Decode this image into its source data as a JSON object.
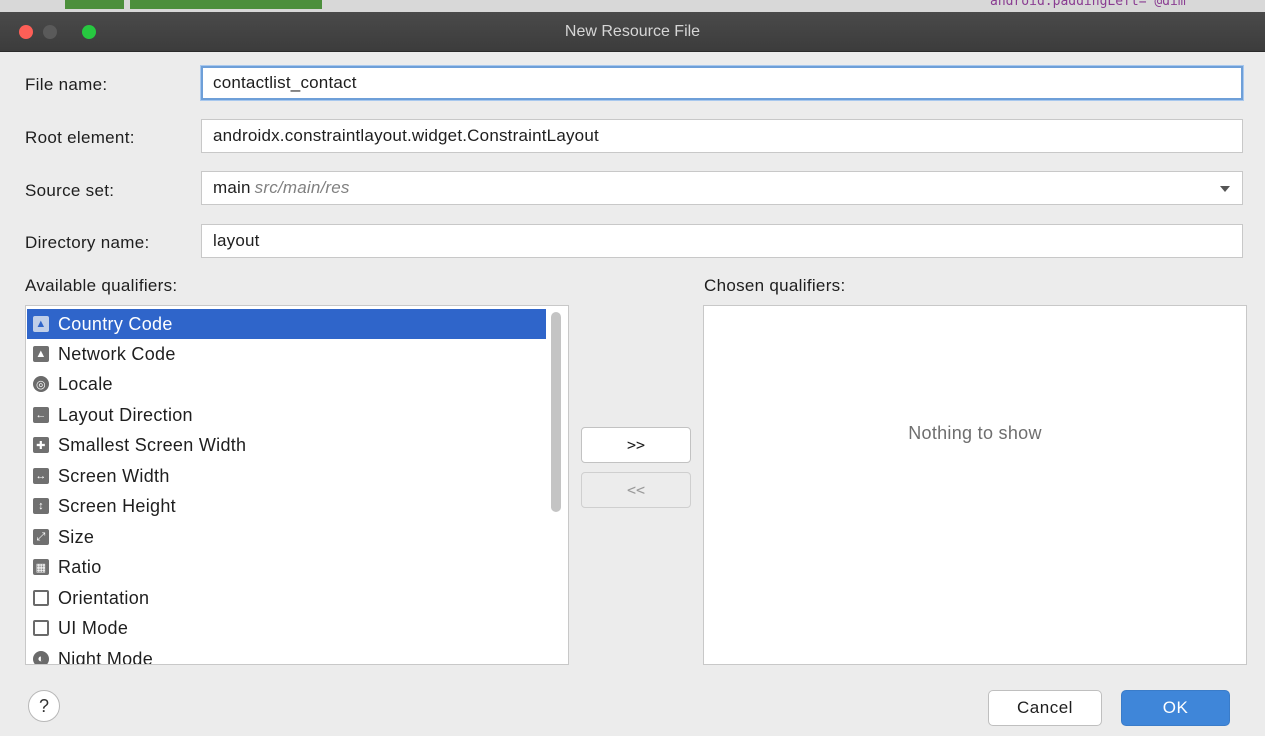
{
  "window": {
    "title": "New Resource File"
  },
  "background_code": "android:paddingLeft=\"@dim",
  "form": {
    "file_name": {
      "label": "File name:",
      "value": "contactlist_contact"
    },
    "root_element": {
      "label": "Root element:",
      "value": "androidx.constraintlayout.widget.ConstraintLayout"
    },
    "source_set": {
      "label": "Source set:",
      "value": "main",
      "hint": "src/main/res"
    },
    "directory_name": {
      "label": "Directory name:",
      "value": "layout"
    }
  },
  "available_qualifiers": {
    "label": "Available qualifiers:",
    "items": [
      {
        "label": "Country Code",
        "icon": "country-code-icon",
        "selected": true
      },
      {
        "label": "Network Code",
        "icon": "network-code-icon",
        "selected": false
      },
      {
        "label": "Locale",
        "icon": "globe-icon",
        "selected": false
      },
      {
        "label": "Layout Direction",
        "icon": "layout-direction-icon",
        "selected": false
      },
      {
        "label": "Smallest Screen Width",
        "icon": "smallest-width-icon",
        "selected": false
      },
      {
        "label": "Screen Width",
        "icon": "screen-width-icon",
        "selected": false
      },
      {
        "label": "Screen Height",
        "icon": "screen-height-icon",
        "selected": false
      },
      {
        "label": "Size",
        "icon": "size-icon",
        "selected": false
      },
      {
        "label": "Ratio",
        "icon": "ratio-icon",
        "selected": false
      },
      {
        "label": "Orientation",
        "icon": "orientation-icon",
        "selected": false
      },
      {
        "label": "UI Mode",
        "icon": "ui-mode-icon",
        "selected": false
      },
      {
        "label": "Night Mode",
        "icon": "night-mode-icon",
        "selected": false
      }
    ]
  },
  "transfer": {
    "add_label": ">>",
    "remove_label": "<<"
  },
  "chosen_qualifiers": {
    "label": "Chosen qualifiers:",
    "empty_text": "Nothing to show"
  },
  "buttons": {
    "help_label": "?",
    "cancel_label": "Cancel",
    "ok_label": "OK"
  },
  "colors": {
    "selection": "#2f65ca",
    "ok_button": "#3f86d9",
    "focus_ring": "#6e9fd8"
  }
}
